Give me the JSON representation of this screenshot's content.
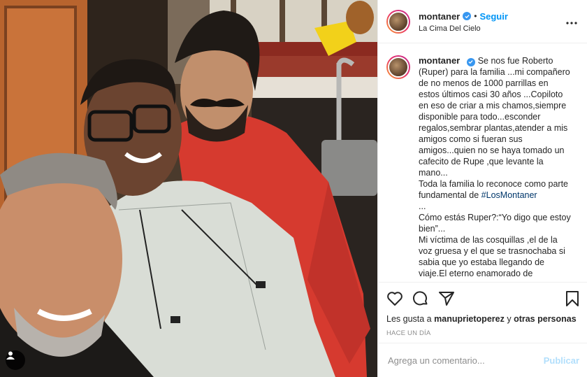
{
  "post": {
    "username": "montaner",
    "follow_label": "Seguir",
    "location": "La Cima Del Cielo",
    "caption": {
      "line1": "Se nos fue Roberto (Ruper) para la familia ...mi compañero de no menos de 1000 parrillas en estos últimos casi 30 años ...Copiloto en eso de criar a mis chamos,siempre disponible para todo...esconder regalos,sembrar plantas,atender a mis amigos como si fueran sus amigos...quien no se haya tomado un cafecito de Rupe ,que levante la mano...",
      "line2_prefix": "Toda la familia lo reconoce como parte fundamental de",
      "hashtag": "#LosMontaner",
      "line3": "...",
      "line4": "Cómo estás Ruper?:“Yo digo que estoy bien”...",
      "line5": "Mi víctima de las cosquillas ,el de la voz gruesa y el que se trasnochaba si sabia que yo estaba llegando de viaje.El eterno enamorado de"
    },
    "likes": {
      "prefix": "Les gusta a",
      "user": "manuprietoperez",
      "connector": "y",
      "others": "otras personas"
    },
    "time_ago": "HACE UN DÍA",
    "comment_placeholder": "Agrega un comentario...",
    "publish_label": "Publicar"
  },
  "icons": [
    "verified-badge-icon",
    "more-options-icon",
    "heart-icon",
    "comment-icon",
    "share-icon",
    "bookmark-icon",
    "user-tag-icon"
  ],
  "colors": {
    "link_blue": "#0095f6",
    "publish_disabled": "#b2dffc",
    "muted_text": "#8e8e8e",
    "hashtag": "#00376b"
  }
}
